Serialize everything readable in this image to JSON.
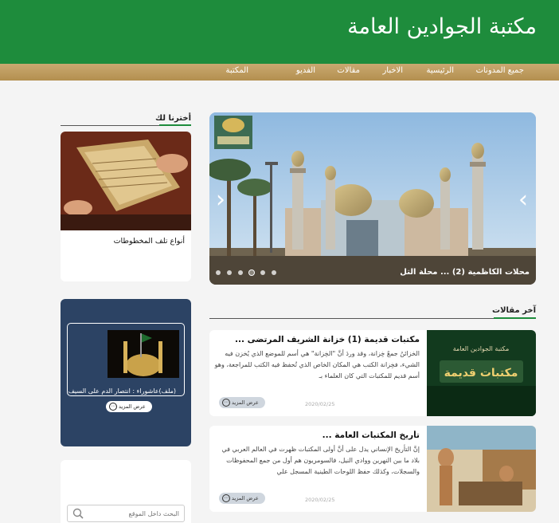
{
  "header": {
    "title": "مكتبة الجوادين العامة"
  },
  "nav": {
    "items": [
      {
        "label": "جميع المدونات"
      },
      {
        "label": "الرئيسية"
      },
      {
        "label": "الاخبار"
      },
      {
        "label": "مقالات"
      },
      {
        "label": "الفديو"
      },
      {
        "label": "المكتبة"
      }
    ]
  },
  "slider": {
    "caption": "محلات الكاظمية (2) ... محلة التل",
    "dots": 6,
    "active_dot": 4
  },
  "sidebar": {
    "picked_title": "أخترنا لك",
    "featured_caption": "أنواع تلف المخطوطات",
    "dark_caption": "(ملف)عاشوراء : انتصار الدم على السيف",
    "dark_button": "عرض المزيد",
    "search_placeholder": "البحث داخل الموقع"
  },
  "articles_section": {
    "title": "آخر مقالات"
  },
  "articles": [
    {
      "title": "مكتبات قديمة (1) خزانة الشريف المرتضى ...",
      "excerpt": "الخزائنُ جمعٌ خِزانة، وقد وردَ أنَّ \"الخِزانة\" هي أسم للموضع الذي يُخزن فيه الشيء، فخِزانة الكتب هي المكان الخاص الذي تُحفظ فيه الكتب للمراجعة، وهو أسم قديم للمكتبات التي كان العلماء بـ",
      "date": "2020/02/25",
      "button": "عرض المزيد",
      "thumb_line1": "مكتبة الجوادين العامة",
      "thumb_line2": "مكتبات قديمة"
    },
    {
      "title": "تأريخ المكتبات العامة ...",
      "excerpt": "إنَّ التأريخ الإنساني يدل على أنَّ أولى المكتبات ظهرت في العالم العربي في بلاد  ما بين النهرين ووادي النيل، فالسومريون هم أول من جمع المحفوظات  والسجلات، وكذلك حفظ اللوحات الطينية المسجل علي",
      "date": "2020/02/25",
      "button": "عرض المزيد"
    }
  ],
  "colors": {
    "header_green": "#1e8c3c",
    "nav_gold": "#b38f4f",
    "panel_navy": "#2c4364"
  }
}
